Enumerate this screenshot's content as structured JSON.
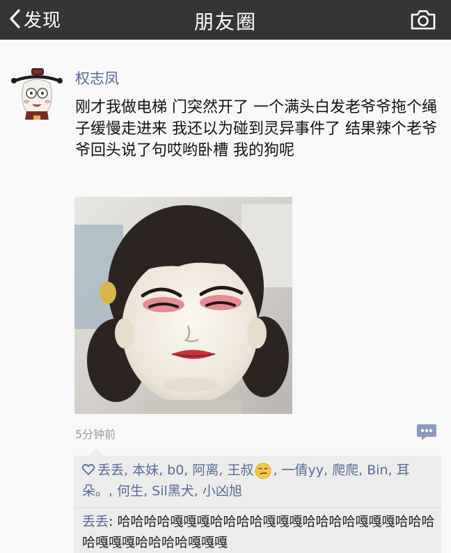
{
  "navbar": {
    "back_label": "发现",
    "title": "朋友圈",
    "back_icon": "chevron-left-icon",
    "camera_icon": "camera-icon"
  },
  "post": {
    "author": "权志凤",
    "text": "刚才我做电梯 门突然开了 一个满头白发老爷爷拖个绳子缓慢走进来 我还以为碰到灵异事件了 结果辣个老爷爷回头说了句哎哟卧槽 我的狗呢",
    "timestamp": "5分钟前",
    "comment_icon": "comment-icon"
  },
  "likes": {
    "icon": "heart-icon",
    "names_before_emoji": "丢丢, 本妹, b0, 阿离, 王叔",
    "names_after_emoji": ", 一倩yy, 爬爬, Bin, 耳朵。, 何生, Sil黑犬, 小凶旭"
  },
  "comment": {
    "author": "丢丢",
    "separator": ": ",
    "text": "哈哈哈哈嘎嘎嘎哈哈哈哈嘎嘎嘎哈哈哈哈嘎嘎嘎哈哈哈哈嘎嘎嘎哈哈哈哈嘎嘎嘎"
  },
  "colors": {
    "navbar_bg": "#353535",
    "link_blue": "#576b95",
    "page_bg": "#f8f8f8",
    "comment_box_bg": "#ececec"
  }
}
